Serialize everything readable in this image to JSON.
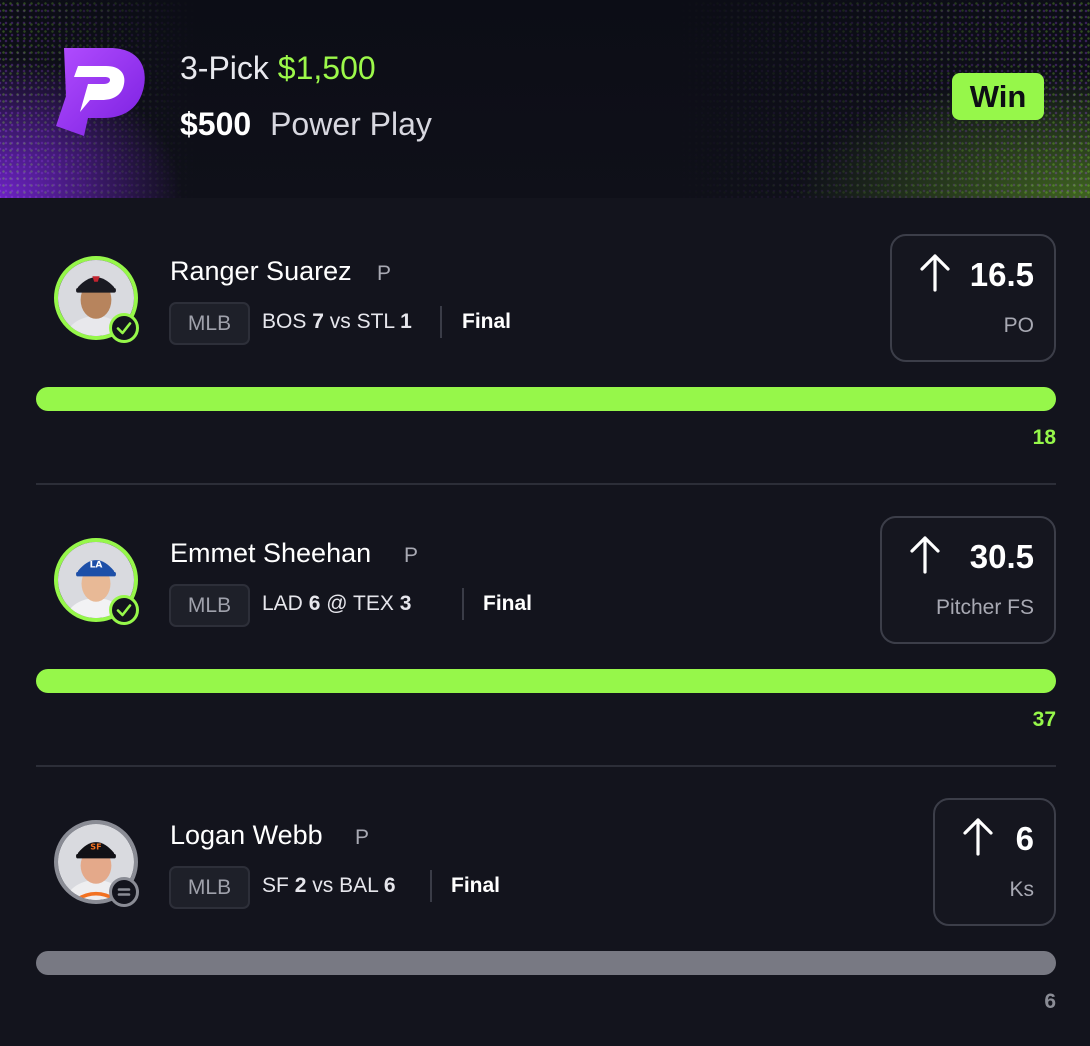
{
  "header": {
    "pick_type": "3-Pick",
    "payout": "$1,500",
    "wager": "$500",
    "play_type": "Power Play",
    "result_badge": "Win",
    "brand_color": "#96f74a"
  },
  "picks": [
    {
      "name": "Ranger Suarez",
      "position": "P",
      "league": "MLB",
      "team1": "BOS",
      "score1": "7",
      "connector": "vs",
      "team2": "STL",
      "score2": "1",
      "game_status": "Final",
      "direction_icon": "arrow-up-icon",
      "line": "16.5",
      "stat": "PO",
      "actual": "18",
      "progress": 1.0,
      "status": "win"
    },
    {
      "name": "Emmet Sheehan",
      "position": "P",
      "league": "MLB",
      "team1": "LAD",
      "score1": "6",
      "connector": "@",
      "team2": "TEX",
      "score2": "3",
      "game_status": "Final",
      "direction_icon": "arrow-up-icon",
      "line": "30.5",
      "stat": "Pitcher FS",
      "actual": "37",
      "progress": 1.0,
      "status": "win"
    },
    {
      "name": "Logan Webb",
      "position": "P",
      "league": "MLB",
      "team1": "SF",
      "score1": "2",
      "connector": "vs",
      "team2": "BAL",
      "score2": "6",
      "game_status": "Final",
      "direction_icon": "arrow-up-icon",
      "line": "6",
      "stat": "Ks",
      "actual": "6",
      "progress": 1.0,
      "status": "push"
    }
  ]
}
